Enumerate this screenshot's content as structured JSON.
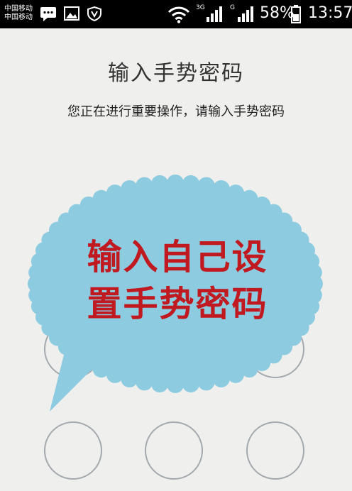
{
  "status_bar": {
    "carrier_1": "中国移动",
    "carrier_2": "中国移动",
    "network_1": "3G",
    "network_2": "G",
    "battery": "58%",
    "time": "13:57"
  },
  "screen": {
    "title": "输入手势密码",
    "subtitle": "您正在进行重要操作，请输入手势密码"
  },
  "overlay": {
    "line1": "输入自己设",
    "line2": "置手势密码",
    "bubble_color": "#8dcbe1",
    "text_color": "#c0191f"
  }
}
